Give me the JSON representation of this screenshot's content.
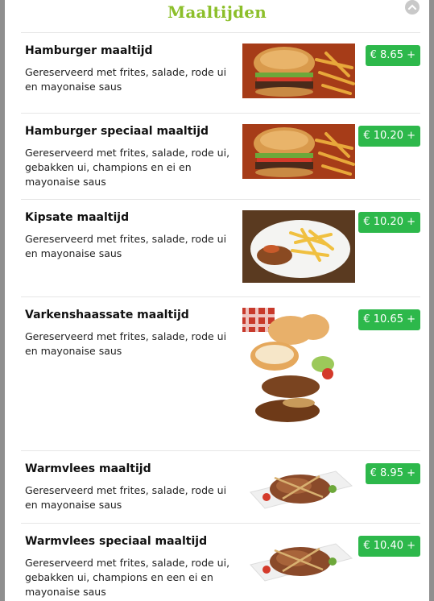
{
  "header": {
    "title": "Maaltijden"
  },
  "items": [
    {
      "name": "Hamburger maaltijd",
      "desc": "Gereserveerd met frites, salade, rode ui en mayonaise saus",
      "price": "€ 8.65 +",
      "image": "burger"
    },
    {
      "name": "Hamburger speciaal maaltijd",
      "desc": "Gereserveerd met frites, salade, rode ui, gebakken ui, champions en ei en mayonaise saus",
      "price": "€ 10.20 +",
      "image": "burger"
    },
    {
      "name": "Kipsate maaltijd",
      "desc": "Gereserveerd met frites, salade, rode ui en mayonaise saus",
      "price": "€ 10.20 +",
      "image": "satay-plate"
    },
    {
      "name": "Varkenshaassate maaltijd",
      "desc": "Gereserveerd met frites, salade, rode ui en mayonaise saus",
      "price": "€ 10.65 +",
      "image": "pork-satay"
    },
    {
      "name": "Warmvlees maaltijd",
      "desc": "Gereserveerd met frites, salade, rode ui en mayonaise saus",
      "price": "€ 8.95 +",
      "image": "warm-meat"
    },
    {
      "name": "Warmvlees speciaal maaltijd",
      "desc": "Gereserveerd met frites, salade, rode ui, gebakken ui, champions en een ei en mayonaise saus",
      "price": "€ 10.40 +",
      "image": "warm-meat"
    }
  ],
  "icons": {
    "close": "close-icon"
  },
  "colors": {
    "title": "#8cbf2a",
    "price_badge": "#2db84b"
  }
}
